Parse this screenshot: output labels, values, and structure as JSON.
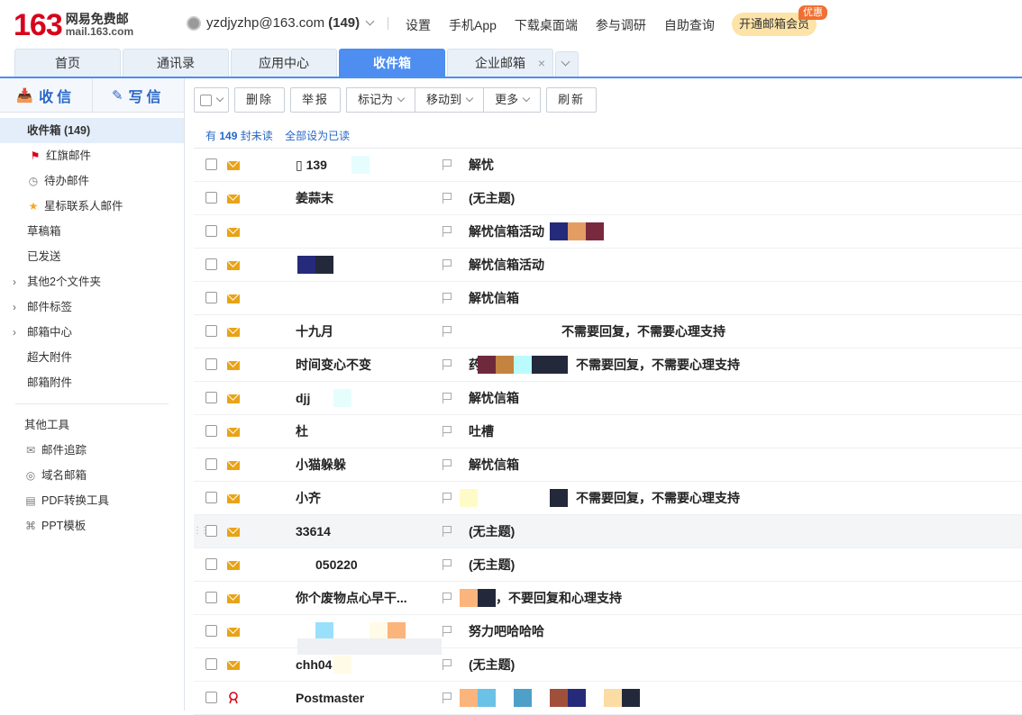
{
  "header": {
    "logo_num": "163",
    "logo_cn": "网易免费邮",
    "logo_en": "mail.163.com",
    "account_email": "yzdjyzhp@163.com",
    "account_count": "(149)",
    "nav": [
      "设置",
      "手机App",
      "下载桌面端",
      "参与调研",
      "自助查询"
    ],
    "vip_label": "开通邮箱会员",
    "vip_badge": "优惠"
  },
  "tabs": [
    {
      "label": "首页",
      "active": false
    },
    {
      "label": "通讯录",
      "active": false
    },
    {
      "label": "应用中心",
      "active": false
    },
    {
      "label": "收件箱",
      "active": true
    },
    {
      "label": "企业邮箱",
      "active": false,
      "closable": true
    }
  ],
  "sidebar": {
    "receive": "收信",
    "write": "写信",
    "folders": [
      {
        "label": "收件箱 (149)",
        "icon": "",
        "active": true
      },
      {
        "label": "红旗邮件",
        "icon": "red-flag-icon"
      },
      {
        "label": "待办邮件",
        "icon": "clock-icon"
      },
      {
        "label": "星标联系人邮件",
        "icon": "star-icon"
      },
      {
        "label": "草稿箱",
        "icon": ""
      },
      {
        "label": "已发送",
        "icon": ""
      },
      {
        "label": "其他2个文件夹",
        "icon": "",
        "expand": true
      },
      {
        "label": "邮件标签",
        "icon": "",
        "expand": true
      },
      {
        "label": "邮箱中心",
        "icon": "",
        "expand": true
      },
      {
        "label": "超大附件",
        "icon": ""
      },
      {
        "label": "邮箱附件",
        "icon": ""
      }
    ],
    "tools_title": "其他工具",
    "tools": [
      {
        "label": "邮件追踪",
        "icon": "mail-track-icon"
      },
      {
        "label": "域名邮箱",
        "icon": "globe-icon"
      },
      {
        "label": "PDF转换工具",
        "icon": "pdf-icon"
      },
      {
        "label": "PPT模板",
        "icon": "ppt-icon"
      }
    ]
  },
  "toolbar": {
    "delete": "删除",
    "report": "举报",
    "mark": "标记为",
    "move": "移动到",
    "more": "更多",
    "refresh": "刷新"
  },
  "unread": {
    "prefix": "有",
    "count": "149",
    "suffix": "封未读",
    "mark_all": "全部设为已读"
  },
  "colors": {
    "accent": "#4d8ef0",
    "logo": "#d9001b",
    "envelope": "#e8a317",
    "vip_bg": "#fde3a7",
    "badge": "#f06f32"
  },
  "emails": [
    {
      "from": "▯ 139",
      "subject": "解忧"
    },
    {
      "from": "姜蒜末",
      "subject": "(无主题)"
    },
    {
      "from": "",
      "subject": "解忧信箱活动"
    },
    {
      "from": "",
      "subject": "解忧信箱活动"
    },
    {
      "from": "",
      "subject": "解忧信箱"
    },
    {
      "from": "十九月",
      "subject": "不需要回复，不需要心理支持"
    },
    {
      "from": "时间变心不变",
      "subject": "药",
      "subject2": "不需要回复，不需要心理支持"
    },
    {
      "from": "djj",
      "subject": "解忧信箱"
    },
    {
      "from": "杜",
      "subject": "吐槽"
    },
    {
      "from": "小猫躲躲",
      "subject": "解忧信箱"
    },
    {
      "from": "小齐",
      "subject": "不需要回复，不需要心理支持"
    },
    {
      "from": "33614",
      "subject": "(无主题)"
    },
    {
      "from": "050220",
      "subject": "(无主题)"
    },
    {
      "from": "你个废物点心早干...",
      "subject": "，不要回复和心理支持"
    },
    {
      "from": "",
      "subject": "努力吧哈哈哈"
    },
    {
      "from": "chh04",
      "subject": "(无主题)"
    },
    {
      "from": "Postmaster",
      "subject": ""
    }
  ]
}
